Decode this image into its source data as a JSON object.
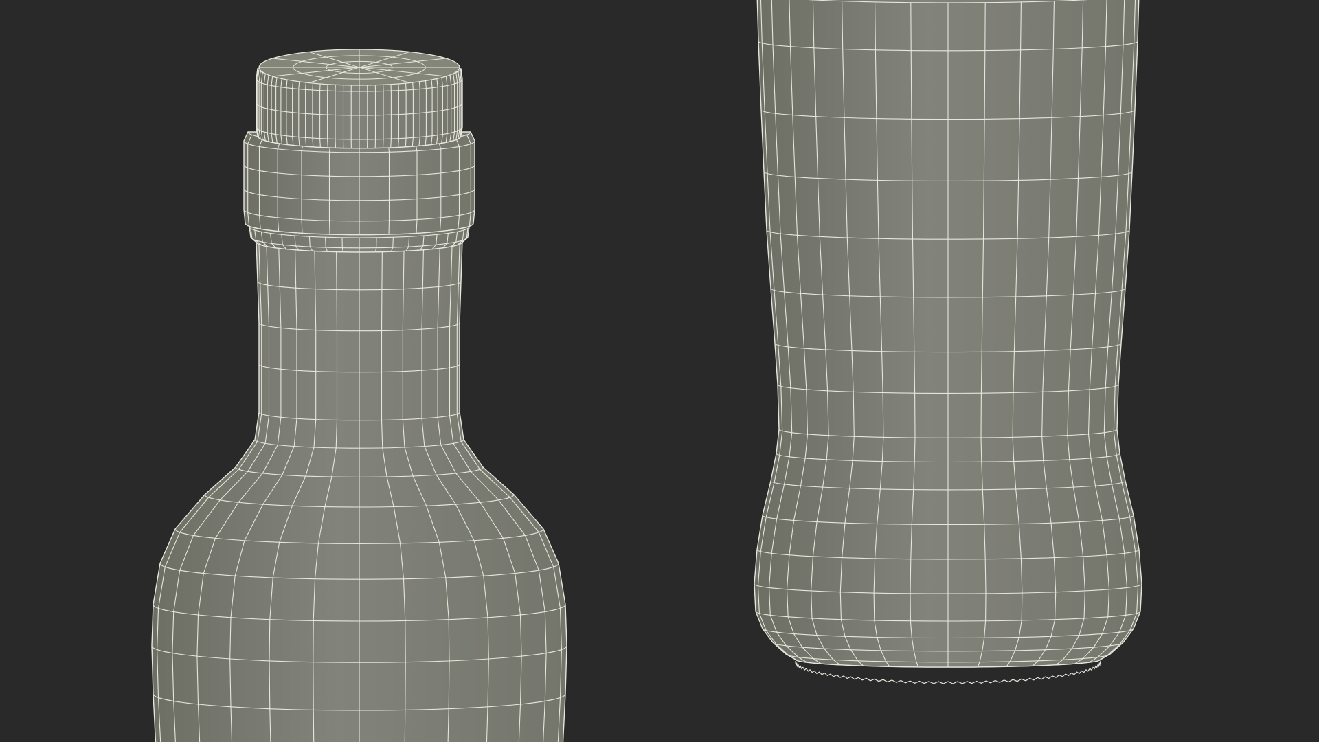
{
  "scene": {
    "background_color": "#292929",
    "surface_color": "#7d7e72",
    "surface_shadow_color": "#6f7066",
    "surface_highlight_color": "#85867a",
    "wire_color": "#e6e6dc",
    "subjects": [
      {
        "name": "bottle-neck-and-cap",
        "view": "upper"
      },
      {
        "name": "bottle-base",
        "view": "lower"
      }
    ]
  }
}
